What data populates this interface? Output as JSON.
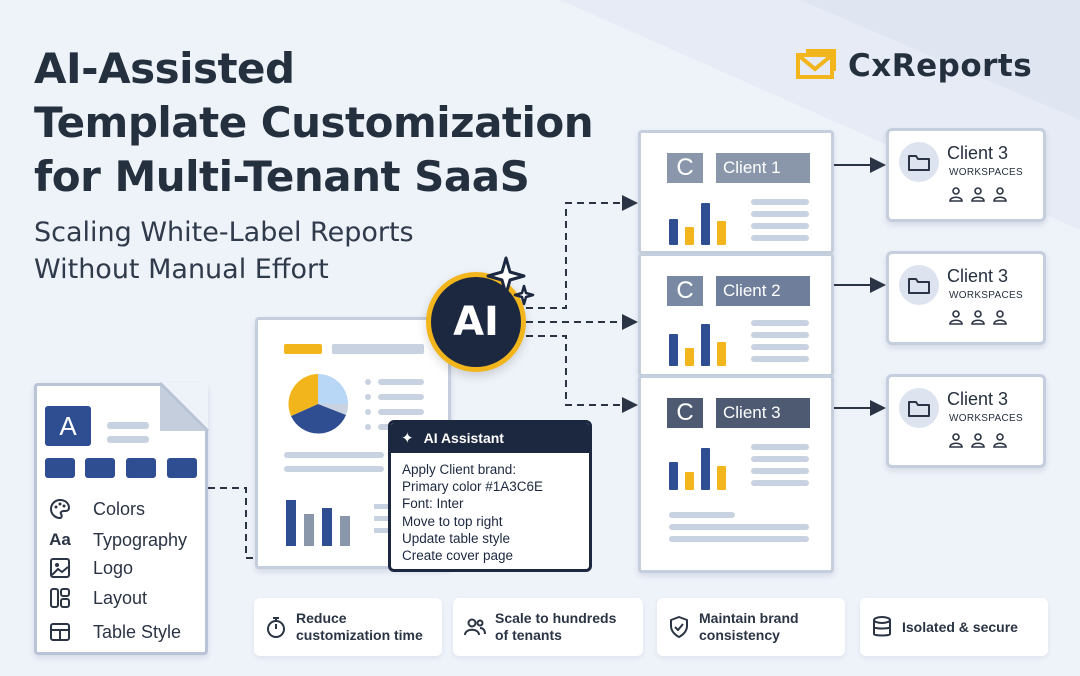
{
  "headline": {
    "line1": "AI-Assisted",
    "line2": "Template Customization",
    "line3": "for Multi-Tenant SaaS"
  },
  "subheadline": {
    "line1": "Scaling White-Label Reports",
    "line2": "Without Manual Effort"
  },
  "brand": {
    "name": "CxReports",
    "icon": "envelope-logo-icon",
    "color": "#f2b51c"
  },
  "template_spec": {
    "letter": "A",
    "items": [
      {
        "icon": "palette-icon",
        "label": "Colors"
      },
      {
        "icon": "Aa",
        "label": "Typography"
      },
      {
        "icon": "image-icon",
        "label": "Logo"
      },
      {
        "icon": "layout-icon",
        "label": "Layout"
      },
      {
        "icon": "table-icon",
        "label": "Table Style"
      }
    ]
  },
  "ai_badge": {
    "label": "AI",
    "icon": "sparkles-icon"
  },
  "ai_assistant": {
    "title": "AI Assistant",
    "icon": "sparkle-icon",
    "lines": [
      "Apply Client brand:",
      "Primary color #1A3C6E",
      "Font: Inter",
      "Move to top right",
      "Update table style",
      "Create cover page"
    ]
  },
  "clients": [
    {
      "logo": "C",
      "name": "Client 1"
    },
    {
      "logo": "C",
      "name": "Client 2"
    },
    {
      "logo": "C",
      "name": "Client 3"
    }
  ],
  "workspaces": [
    {
      "name": "Client 3",
      "label": "WORKSPACES"
    },
    {
      "name": "Client 3",
      "label": "WORKSPACES"
    },
    {
      "name": "Client 3",
      "label": "WORKSPACES"
    }
  ],
  "features": [
    {
      "icon": "stopwatch-icon",
      "line1": "Reduce",
      "line2": "customization time"
    },
    {
      "icon": "users-icon",
      "line1": "Scale to hundreds",
      "line2": "of tenants"
    },
    {
      "icon": "shield-check-icon",
      "line1": "Maintain brand",
      "line2": "consistency"
    },
    {
      "icon": "database-icon",
      "line1": "Isolated & secure",
      "line2": ""
    }
  ],
  "colors": {
    "navy": "#1c2840",
    "accent_blue": "#2e4e91",
    "gold": "#f2b51c",
    "light_blue": "#b8d6f5"
  }
}
